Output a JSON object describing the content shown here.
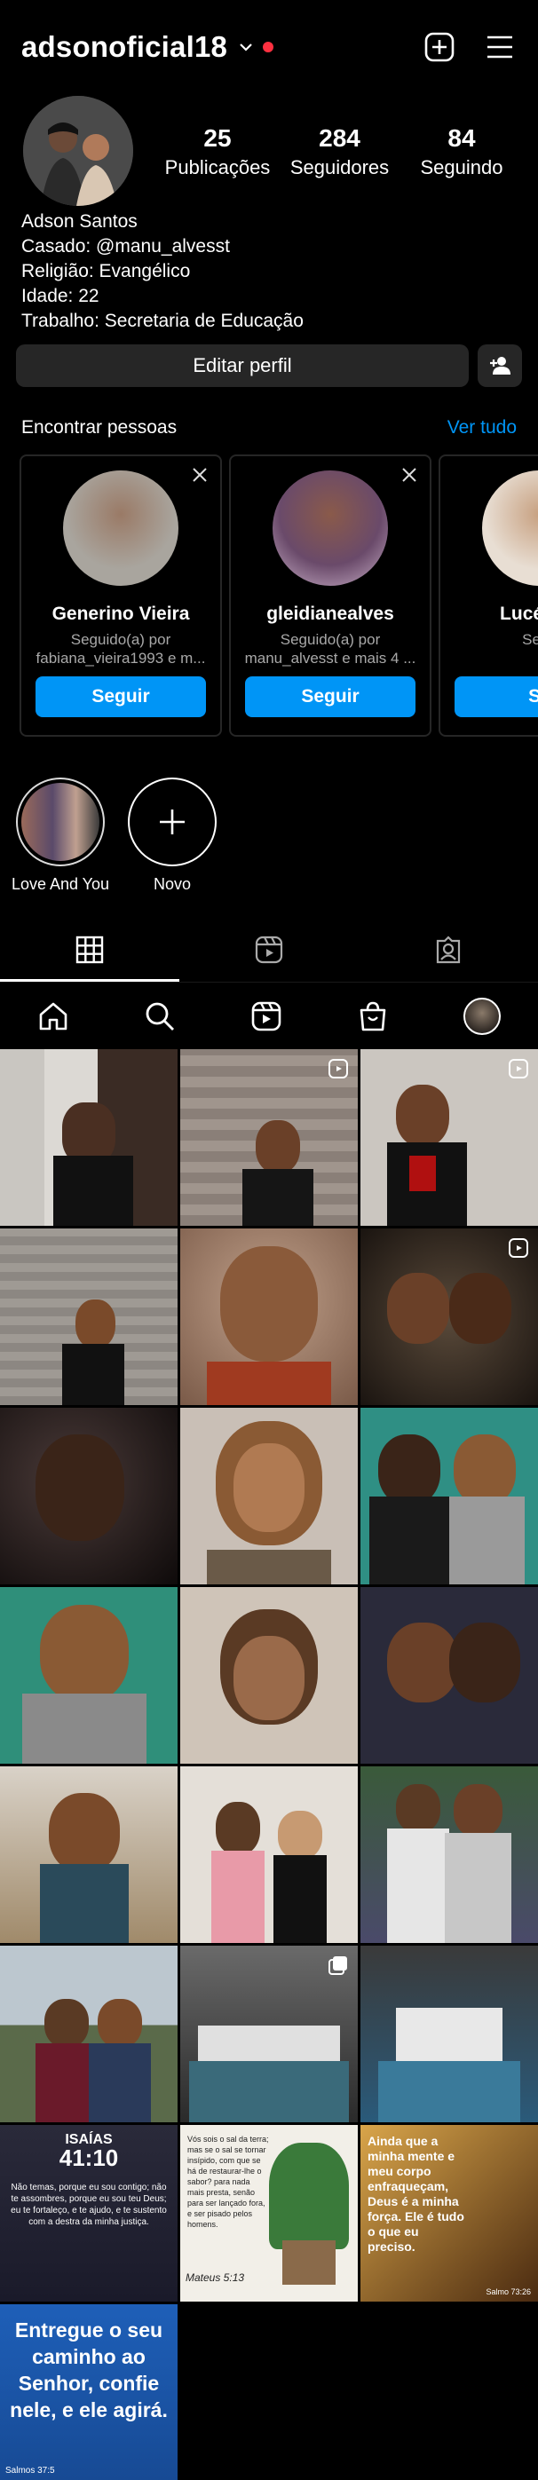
{
  "header": {
    "username": "adsonoficial18",
    "icons": [
      "chevron-down-icon",
      "new-post-icon",
      "menu-icon"
    ],
    "notification_dot_color": "#ff3040"
  },
  "profile": {
    "stats": [
      {
        "value": "25",
        "label": "Publicações"
      },
      {
        "value": "284",
        "label": "Seguidores"
      },
      {
        "value": "84",
        "label": "Seguindo"
      }
    ],
    "bio": [
      "Adson Santos",
      "Casado: @manu_alvesst",
      "Religião: Evangélico",
      "Idade: 22",
      "Trabalho: Secretaria de Educação"
    ],
    "edit_label": "Editar perfil"
  },
  "find_people": {
    "title": "Encontrar pessoas",
    "see_all": "Ver tudo",
    "accent": "#0095f6",
    "cards": [
      {
        "name": "Generino Vieira",
        "sub": "Seguido(a) por fabiana_vieira1993 e m...",
        "button": "Seguir"
      },
      {
        "name": "gleidianealves",
        "sub": "Seguido(a) por manu_alvesst e mais 4 ...",
        "button": "Seguir"
      },
      {
        "name": "Lucélia s",
        "sub": "Segu",
        "button": "Se"
      }
    ]
  },
  "highlights": [
    {
      "label": "Love And You"
    },
    {
      "label": "Novo"
    }
  ],
  "tabs": [
    "grid-icon",
    "reels-icon",
    "tagged-icon"
  ],
  "nav": [
    "home-icon",
    "search-icon",
    "reels-icon",
    "shop-icon",
    "profile-avatar"
  ],
  "posts": {
    "verse1_ref": "ISAÍAS",
    "verse1_num": "41:10",
    "verse1_text": "Não temas, porque eu sou contigo; não te assombres, porque eu sou teu Deus; eu te fortaleço, e te ajudo, e te sustento com a destra da minha justiça.",
    "verse2_text": "Vós sois o sal da terra; mas se o sal se tornar insípido, com que se há de restaurar-lhe o sabor? para nada mais presta, senão para ser lançado fora, e ser pisado pelos homens.",
    "verse2_ref": "Mateus 5:13",
    "verse3_text": "Ainda que a minha mente e meu corpo enfraqueçam, Deus é a minha força. Ele é tudo o que eu preciso.",
    "verse3_ref": "Salmo 73:26",
    "verse4_text": "Entregue o seu caminho ao Senhor, confie nele, e ele agirá.",
    "verse4_ref": "Salmos 37:5"
  }
}
